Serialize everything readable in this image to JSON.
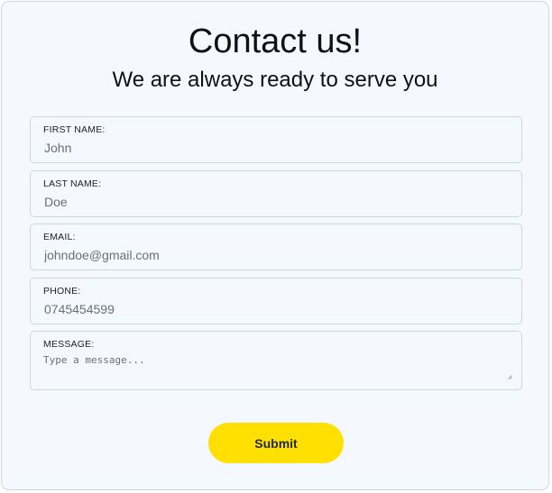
{
  "header": {
    "title": "Contact us!",
    "subtitle": "We are always ready to serve you"
  },
  "form": {
    "first_name": {
      "label": "FIRST NAME:",
      "value": "John"
    },
    "last_name": {
      "label": "LAST NAME:",
      "value": "Doe"
    },
    "email": {
      "label": "EMAIL:",
      "value": "johndoe@gmail.com"
    },
    "phone": {
      "label": "PHONE:",
      "value": "0745454599"
    },
    "message": {
      "label": "MESSAGE:",
      "placeholder": "Type a message..."
    },
    "submit_label": "Submit"
  },
  "colors": {
    "background": "#f5f8ff",
    "border": "#cfd6e3",
    "button": "#ffe000",
    "button_text": "#1e2a3a"
  },
  "icons": {
    "resize": "resize-handle-icon"
  }
}
